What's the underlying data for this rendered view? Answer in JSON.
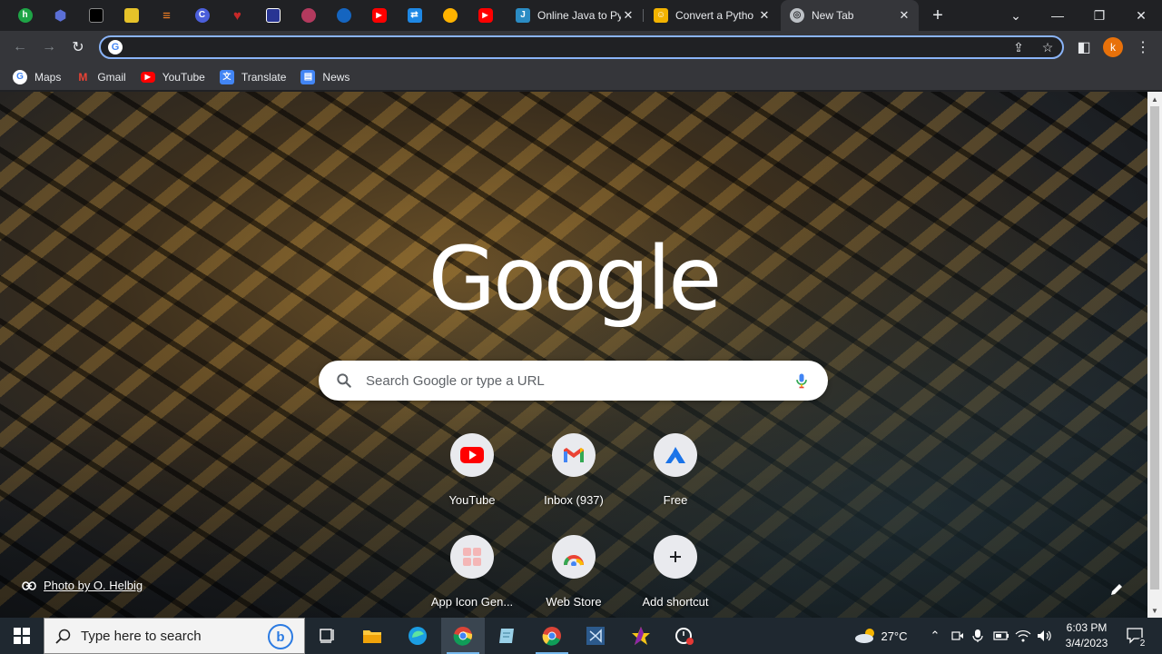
{
  "browser": {
    "pinned_tabs": [
      {
        "icon": "hotjar-icon",
        "color": "#1ea446",
        "glyph": "h"
      },
      {
        "icon": "hexagon-icon",
        "color": "#5b6fd6",
        "glyph": "⬢"
      },
      {
        "icon": "toolbox-icon",
        "color": "#000000",
        "glyph": "■"
      },
      {
        "icon": "image-icon",
        "color": "#e6c229",
        "glyph": "▣"
      },
      {
        "icon": "stack-icon",
        "color": "#f48024",
        "glyph": "≡"
      },
      {
        "icon": "c-logo-icon",
        "color": "#4b5fdb",
        "glyph": "C"
      },
      {
        "icon": "heart-icon",
        "color": "#c62828",
        "glyph": "♥"
      },
      {
        "icon": "crest-icon",
        "color": "#283593",
        "glyph": "▼"
      },
      {
        "icon": "badge-icon",
        "color": "#b33a5e",
        "glyph": "✿"
      },
      {
        "icon": "shield-icon",
        "color": "#1565c0",
        "glyph": "◆"
      },
      {
        "icon": "youtube-icon",
        "color": "#ff0000",
        "glyph": "▶"
      },
      {
        "icon": "arrows-icon",
        "color": "#1e88e5",
        "glyph": "⇄"
      },
      {
        "icon": "flame-icon",
        "color": "#ffb300",
        "glyph": "◉"
      },
      {
        "icon": "youtube-icon",
        "color": "#ff0000",
        "glyph": "▶"
      }
    ],
    "tabs": [
      {
        "title": "Online Java to Py",
        "icon": "j-icon",
        "color": "#2b8cc4",
        "glyph": "J",
        "active": false
      },
      {
        "title": "Convert a Pytho",
        "icon": "converter-icon",
        "color": "#f3b300",
        "glyph": "☺",
        "active": false
      },
      {
        "title": "New Tab",
        "icon": "chrome-icon",
        "color": "#bdc1c6",
        "glyph": "◎",
        "active": true
      }
    ],
    "profile_initial": "k",
    "omnibox": {
      "value": "",
      "placeholder": ""
    },
    "bookmarks": [
      {
        "label": "Maps",
        "icon": "google-icon",
        "color": "#ffffff",
        "glyph": "G"
      },
      {
        "label": "Gmail",
        "icon": "gmail-icon",
        "color": "#ea4335",
        "glyph": "M"
      },
      {
        "label": "YouTube",
        "icon": "youtube-icon",
        "color": "#ff0000",
        "glyph": "▶"
      },
      {
        "label": "Translate",
        "icon": "translate-icon",
        "color": "#4285f4",
        "glyph": "文"
      },
      {
        "label": "News",
        "icon": "news-icon",
        "color": "#4285f4",
        "glyph": "▤"
      }
    ]
  },
  "ntp": {
    "logo_text": "Google",
    "search_placeholder": "Search Google or type a URL",
    "shortcuts": [
      {
        "label": "YouTube",
        "icon": "youtube-icon"
      },
      {
        "label": "Inbox (937)",
        "icon": "gmail-icon"
      },
      {
        "label": "Free",
        "icon": "drive-icon"
      },
      {
        "label": "App Icon Gen...",
        "icon": "app-grid-icon"
      },
      {
        "label": "Web Store",
        "icon": "web-store-icon"
      },
      {
        "label": "Add shortcut",
        "icon": "plus-icon"
      }
    ],
    "photo_credit": "Photo by O. Helbig"
  },
  "taskbar": {
    "search_placeholder": "Type here to search",
    "weather": "27°C",
    "time": "6:03 PM",
    "date": "3/4/2023",
    "notification_count": "2"
  }
}
